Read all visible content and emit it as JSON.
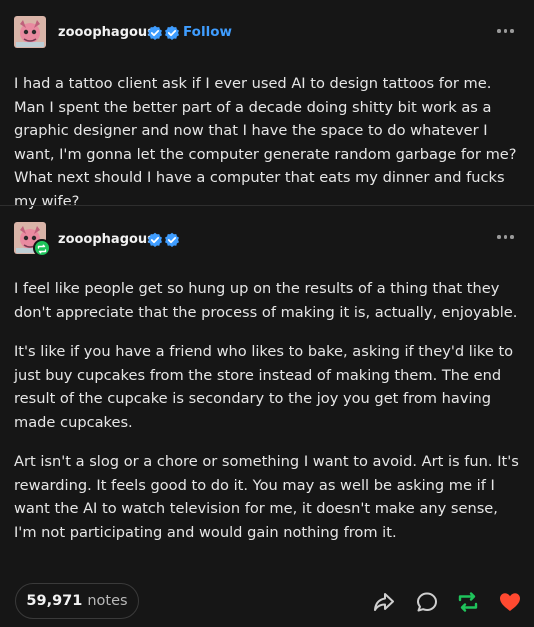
{
  "post": {
    "author": "zooophagous",
    "follow_label": "Follow",
    "body": "I had a tattoo client ask if I ever used AI to design tattoos for me. Man I spent the better part of a decade doing shitty bit work as a graphic designer and now that I have the space to do whatever I want, I'm gonna let the computer generate random garbage for me? What next should I have a computer that eats my dinner and fucks my wife?"
  },
  "reblog": {
    "author": "zooophagous",
    "paragraphs": [
      "I feel like people get so hung up on the results of a thing that they don't appreciate that the process of making it is, actually, enjoyable.",
      "It's like if you have a friend who likes to bake, asking if they'd like to just buy cupcakes from the store instead of making them. The end result of the cupcake is secondary to the joy you get from having made cupcakes.",
      "Art isn't a slog or a chore or something I want to avoid. Art is fun. It's rewarding. It feels good to do it. You may as well be asking me if I want the AI to watch television for me, it doesn't make any sense, I'm not participating and would gain nothing from it."
    ]
  },
  "footer": {
    "notes_count": "59,971",
    "notes_label": "notes"
  },
  "icons": {
    "badge": "verified-badge-icon",
    "more": "more-options-icon",
    "share": "share-icon",
    "reply": "reply-icon",
    "reblog": "reblog-icon",
    "like": "heart-icon"
  },
  "colors": {
    "background": "#161616",
    "link_blue": "#3f9dff",
    "reblog_green": "#1fc35b",
    "like_red": "#ff4930"
  }
}
